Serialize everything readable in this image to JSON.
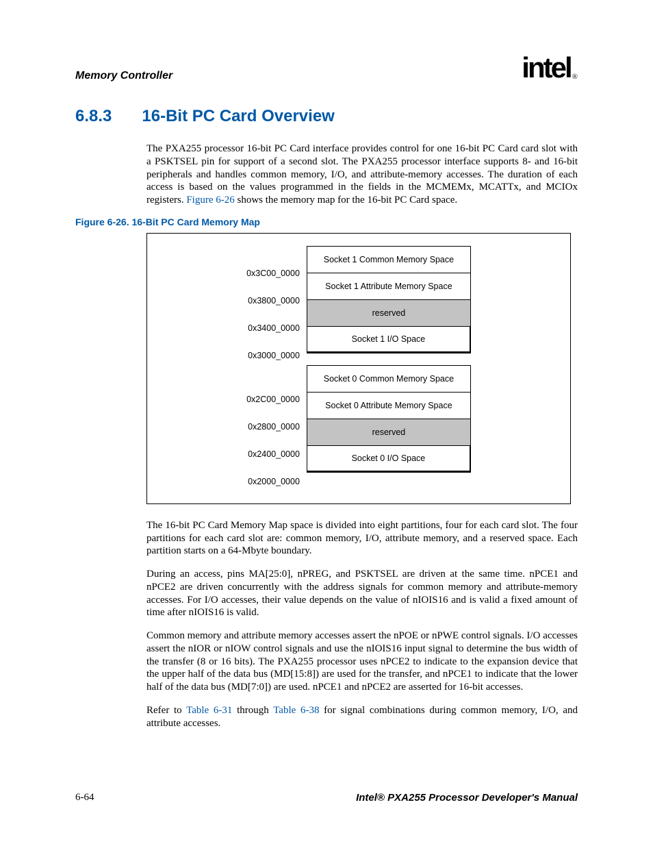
{
  "header": {
    "running_title": "Memory Controller",
    "logo_text": "intel",
    "logo_reg": "®"
  },
  "section": {
    "number": "6.8.3",
    "title": "16-Bit PC Card Overview"
  },
  "para1_a": "The PXA255 processor 16-bit PC Card interface provides control for one 16-bit PC Card card slot with a PSKTSEL pin for support of a second slot. The PXA255 processor interface supports 8- and 16-bit peripherals and handles common memory, I/O, and attribute-memory accesses. The duration of each access is based on the values programmed in the fields in the MCMEMx, MCATTx, and MCIOx registers. ",
  "para1_link": "Figure 6-26",
  "para1_b": " shows the memory map for the 16-bit PC Card space.",
  "figure": {
    "caption": "Figure 6-26. 16-Bit PC Card Memory Map",
    "addresses": [
      "0x3C00_0000",
      "0x3800_0000",
      "0x3400_0000",
      "0x3000_0000",
      "0x2C00_0000",
      "0x2800_0000",
      "0x2400_0000",
      "0x2000_0000"
    ],
    "socket1": [
      "Socket 1 Common Memory Space",
      "Socket 1 Attribute Memory Space",
      "reserved",
      "Socket 1 I/O Space"
    ],
    "socket0": [
      "Socket 0 Common Memory Space",
      "Socket 0 Attribute Memory Space",
      "reserved",
      "Socket 0 I/O Space"
    ]
  },
  "para2": "The 16-bit PC Card Memory Map space is divided into eight partitions, four for each card slot. The four partitions for each card slot are: common memory, I/O, attribute memory, and a reserved space. Each partition starts on a 64-Mbyte boundary.",
  "para3": "During an access, pins MA[25:0], nPREG, and PSKTSEL are driven at the same time. nPCE1 and nPCE2 are driven concurrently with the address signals for common memory and attribute-memory accesses. For I/O accesses, their value depends on the value of nIOIS16 and is valid a fixed amount of time after nIOIS16 is valid.",
  "para4": "Common memory and attribute memory accesses assert the nPOE or nPWE control signals. I/O accesses assert the nIOR or nIOW control signals and use the nIOIS16 input signal to determine the bus width of the transfer (8 or 16 bits). The PXA255 processor uses nPCE2 to indicate to the expansion device that the upper half of the data bus (MD[15:8]) are used for the transfer, and nPCE1 to indicate that the lower half of the data bus (MD[7:0]) are used. nPCE1 and nPCE2 are asserted for 16-bit accesses.",
  "para5_a": "Refer to ",
  "para5_link1": "Table 6-31",
  "para5_b": " through ",
  "para5_link2": "Table 6-38",
  "para5_c": " for signal combinations during common memory, I/O, and attribute accesses.",
  "footer": {
    "left": "6-64",
    "right": "Intel® PXA255 Processor Developer's Manual"
  }
}
